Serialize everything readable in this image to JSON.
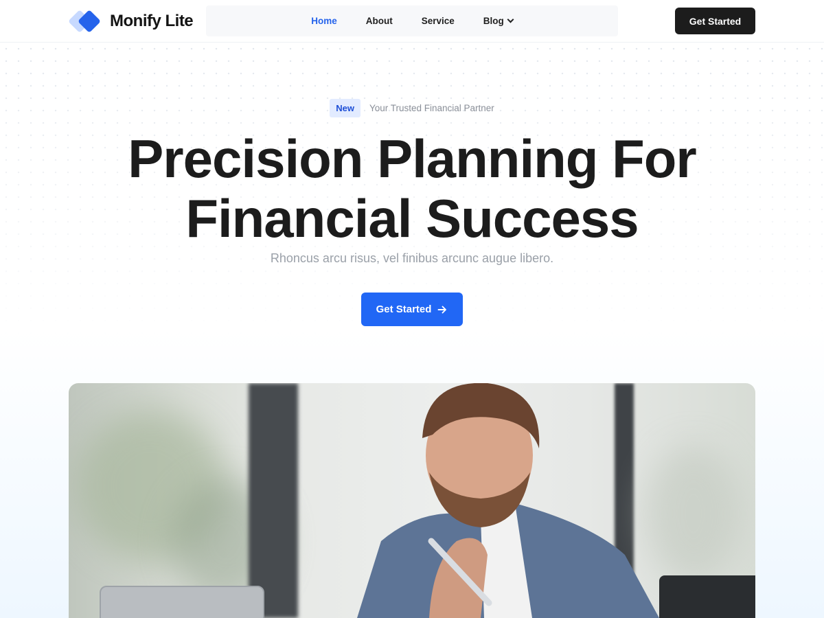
{
  "brand": {
    "name": "Monify Lite"
  },
  "nav": {
    "items": [
      {
        "label": "Home",
        "active": true
      },
      {
        "label": "About",
        "active": false
      },
      {
        "label": "Service",
        "active": false
      },
      {
        "label": "Blog",
        "active": false,
        "has_dropdown": true
      }
    ]
  },
  "header": {
    "cta_label": "Get Started"
  },
  "hero": {
    "badge": "New",
    "tagline": "Your Trusted Financial Partner",
    "title_line1": "Precision Planning For",
    "title_line2": "Financial Success",
    "subtitle": "Rhoncus arcu risus, vel finibus arcunc augue libero.",
    "cta_label": "Get Started"
  },
  "colors": {
    "accent": "#2167f5",
    "dark_button": "#1c1c1c",
    "badge_bg": "#e2ebff",
    "text_dark": "#1c1c1c",
    "text_muted": "#9aa0a8"
  },
  "icons": {
    "logo": "diamond-logo-icon",
    "dropdown": "chevron-down-icon",
    "cta_arrow": "arrow-right-icon"
  },
  "image": {
    "description": "Man in blue blazer holding a pen to his chin, looking at a laptop"
  }
}
